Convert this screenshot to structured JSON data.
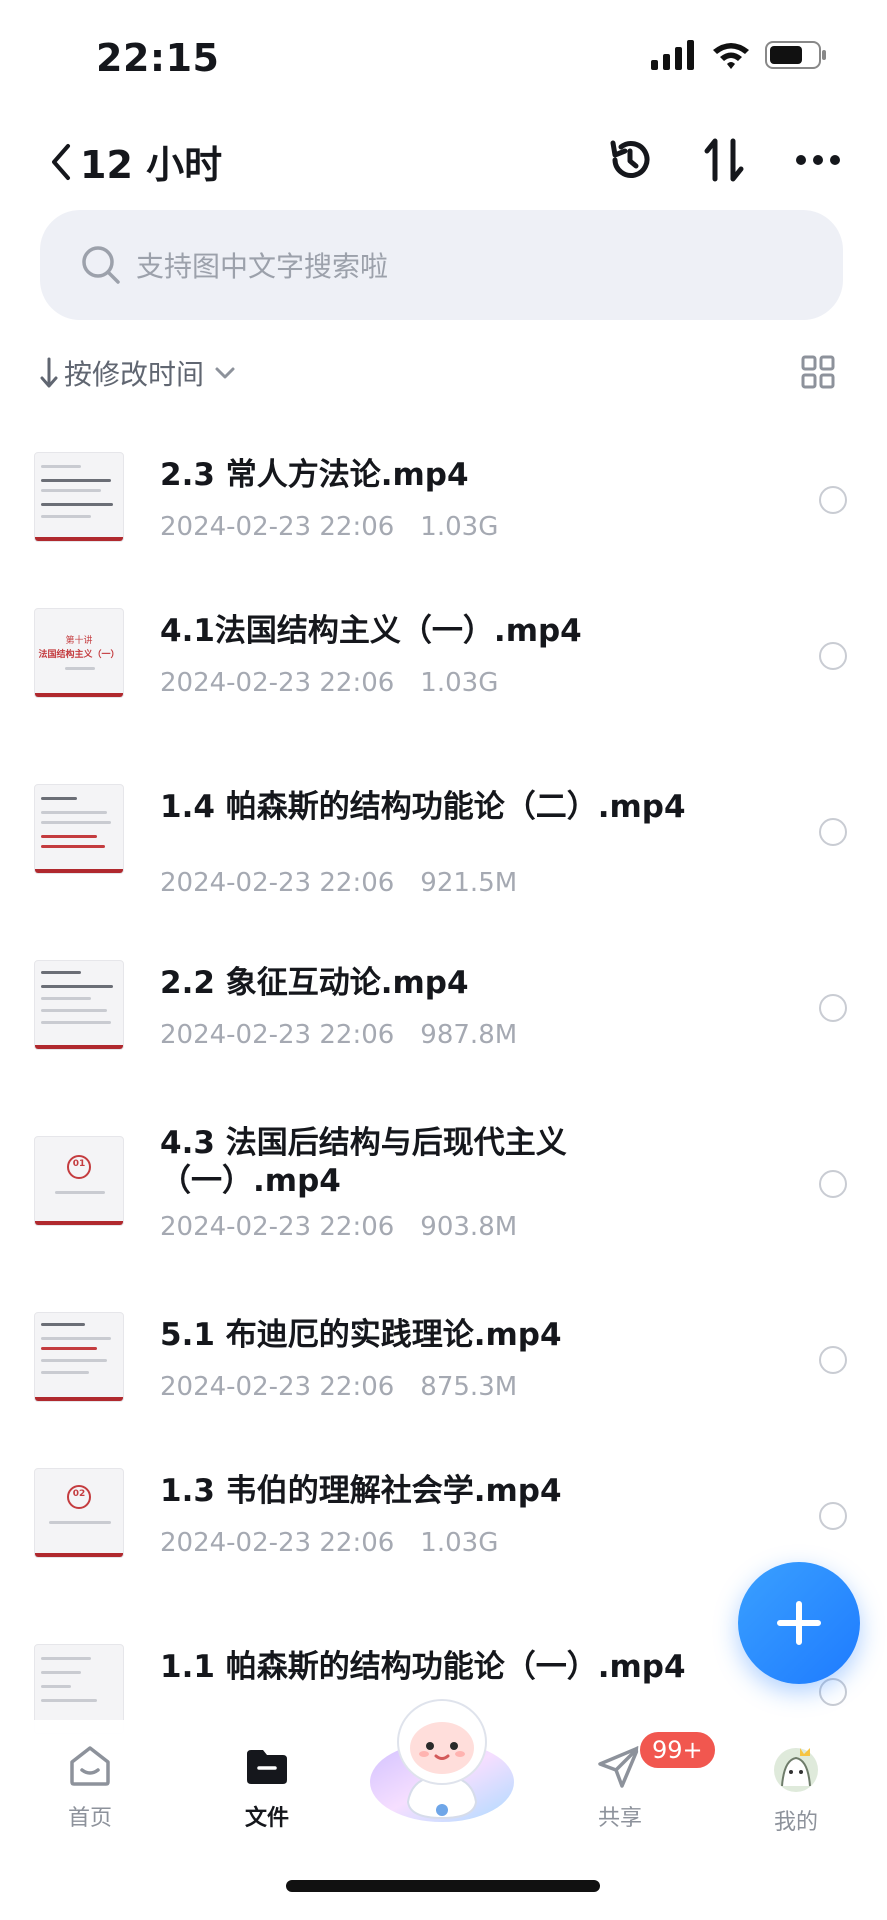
{
  "status_bar": {
    "time": "22:15"
  },
  "header": {
    "back_title": "12 小时"
  },
  "search": {
    "placeholder": "支持图中文字搜索啦"
  },
  "sort": {
    "label": "按修改时间"
  },
  "files": [
    {
      "name": "2.3 常人方法论.mp4",
      "date": "2024-02-23 22:06",
      "size": "1.03G"
    },
    {
      "name": "4.1法国结构主义（一）.mp4",
      "date": "2024-02-23 22:06",
      "size": "1.03G"
    },
    {
      "name": "1.4 帕森斯的结构功能论（二）.mp4",
      "date": "2024-02-23 22:06",
      "size": "921.5M"
    },
    {
      "name": "2.2 象征互动论.mp4",
      "date": "2024-02-23 22:06",
      "size": "987.8M"
    },
    {
      "name_line1": "4.3 法国后结构与后现代主义",
      "name_line2": "（一）.mp4",
      "date": "2024-02-23 22:06",
      "size": "903.8M"
    },
    {
      "name": "5.1 布迪厄的实践理论.mp4",
      "date": "2024-02-23 22:06",
      "size": "875.3M"
    },
    {
      "name": "1.3 韦伯的理解社会学.mp4",
      "date": "2024-02-23 22:06",
      "size": "1.03G"
    },
    {
      "name": "1.1 帕森斯的结构功能论（一）.mp4"
    }
  ],
  "thumbs": {
    "t2_title": "第十讲",
    "t2_sub": "法国结构主义（一）",
    "t5_num": "01",
    "t7_num": "02"
  },
  "tabs": [
    {
      "label": "首页"
    },
    {
      "label": "文件"
    },
    {
      "label": "共享"
    },
    {
      "label": "我的"
    }
  ],
  "badge": {
    "count": "99+"
  },
  "colors": {
    "accent": "#1e7bff",
    "badge": "#f1574f",
    "thumb_red": "#b0292e"
  }
}
